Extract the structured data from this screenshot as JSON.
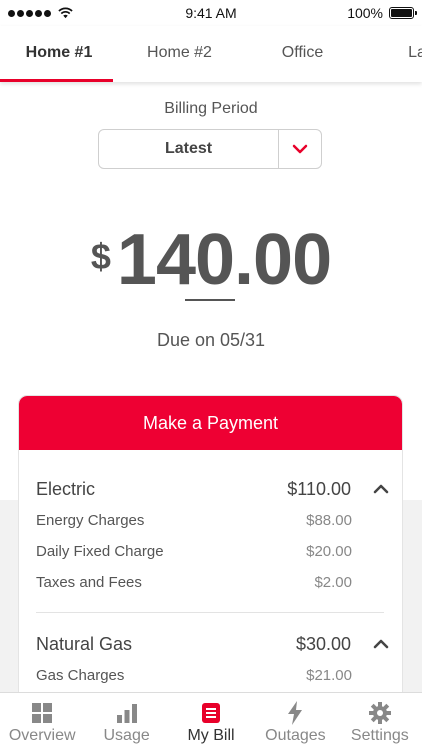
{
  "status_bar": {
    "time": "9:41 AM",
    "battery": "100%"
  },
  "tabs": [
    {
      "label": "Home #1",
      "active": true
    },
    {
      "label": "Home #2",
      "active": false
    },
    {
      "label": "Office",
      "active": false
    },
    {
      "label": "Lake",
      "active": false
    }
  ],
  "billing": {
    "label": "Billing Period",
    "selected": "Latest"
  },
  "amount": {
    "currency": "$",
    "value": "140.00",
    "due": "Due on 05/31"
  },
  "payment_button": "Make a Payment",
  "sections": [
    {
      "name": "Electric",
      "total": "$110.00",
      "lines": [
        {
          "label": "Energy Charges",
          "amount": "$88.00"
        },
        {
          "label": "Daily Fixed Charge",
          "amount": "$20.00"
        },
        {
          "label": "Taxes and Fees",
          "amount": "$2.00"
        }
      ]
    },
    {
      "name": "Natural Gas",
      "total": "$30.00",
      "lines": [
        {
          "label": "Gas Charges",
          "amount": "$21.00"
        }
      ]
    }
  ],
  "nav": [
    {
      "label": "Overview",
      "icon": "grid-icon",
      "active": false
    },
    {
      "label": "Usage",
      "icon": "bar-chart-icon",
      "active": false
    },
    {
      "label": "My Bill",
      "icon": "bill-icon",
      "active": true
    },
    {
      "label": "Outages",
      "icon": "lightning-icon",
      "active": false
    },
    {
      "label": "Settings",
      "icon": "gear-icon",
      "active": false
    }
  ],
  "colors": {
    "accent": "#ee0033",
    "text": "#555555",
    "active_text": "#333333",
    "muted": "#888888"
  }
}
